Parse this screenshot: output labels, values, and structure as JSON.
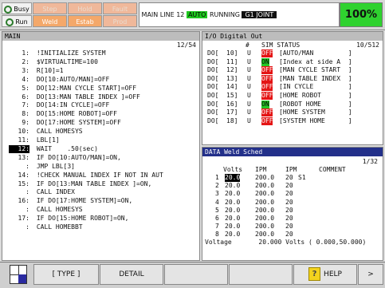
{
  "status": {
    "busy": "Busy",
    "step": "Step",
    "hold": "Hold",
    "fault": "Fault",
    "run": "Run",
    "weld": "Weld",
    "estab": "Estab",
    "prod": "Prod",
    "msg_prefix": "MAIN  LINE 12",
    "auto": "AUTO",
    "running": "RUNNING",
    "group": "G1  JOINT",
    "override": "100%"
  },
  "program": {
    "title": "MAIN",
    "position": "12/54",
    "lines": [
      {
        "num": "1:",
        "text": " !INITIALIZE SYSTEM"
      },
      {
        "num": "2:",
        "text": " $VIRTUALTIME=100"
      },
      {
        "num": "3:",
        "text": " R[10]=1"
      },
      {
        "num": "4:",
        "text": " DO[10:AUTO/MAN]=OFF"
      },
      {
        "num": "5:",
        "text": " DO[12:MAN CYCLE START]=OFF"
      },
      {
        "num": "6:",
        "text": " DO[13:MAN TABLE INDEX ]=OFF"
      },
      {
        "num": "7:",
        "text": " DO[14:IN CYCLE]=OFF"
      },
      {
        "num": "8:",
        "text": " DO[15:HOME ROBOT]=OFF"
      },
      {
        "num": "9:",
        "text": " DO[17:HOME SYSTEM]=OFF"
      },
      {
        "num": "10:",
        "text": " CALL HOMESYS"
      },
      {
        "num": "11:",
        "text": " LBL[1]"
      },
      {
        "num": "12:",
        "text": " WAIT    .50(sec)"
      },
      {
        "num": "13:",
        "text": " IF DO[10:AUTO/MAN]=ON,"
      },
      {
        "num": ":",
        "text": " JMP LBL[3]"
      },
      {
        "num": "14:",
        "text": " !CHECK MANUAL INDEX IF NOT IN AUT"
      },
      {
        "num": "15:",
        "text": " IF DO[13:MAN TABLE INDEX ]=ON,"
      },
      {
        "num": ":",
        "text": " CALL INDEX"
      },
      {
        "num": "16:",
        "text": " IF DO[17:HOME SYSTEM]=ON,"
      },
      {
        "num": ":",
        "text": " CALL HOMESYS"
      },
      {
        "num": "17:",
        "text": " IF DO[15:HOME ROBOT]=ON,"
      },
      {
        "num": ":",
        "text": " CALL HOMEBBT"
      }
    ]
  },
  "io": {
    "title": "I/O Digital Out",
    "header_num": "#",
    "header_sim": "SIM STATUS",
    "position": "10/512",
    "rows": [
      {
        "prefix": "DO[",
        "num": "10]",
        "sim": "U",
        "status": "OFF",
        "comment": "[AUTO/MAN         ]"
      },
      {
        "prefix": "DO[",
        "num": "11]",
        "sim": "U",
        "status": "ON",
        "comment": "[Index at side A  ]"
      },
      {
        "prefix": "DO[",
        "num": "12]",
        "sim": "U",
        "status": "OFF",
        "comment": "[MAN CYCLE START  ]"
      },
      {
        "prefix": "DO[",
        "num": "13]",
        "sim": "U",
        "status": "OFF",
        "comment": "[MAN TABLE INDEX  ]"
      },
      {
        "prefix": "DO[",
        "num": "14]",
        "sim": "U",
        "status": "OFF",
        "comment": "[IN CYCLE         ]"
      },
      {
        "prefix": "DO[",
        "num": "15]",
        "sim": "U",
        "status": "OFF",
        "comment": "[HOME ROBOT       ]"
      },
      {
        "prefix": "DO[",
        "num": "16]",
        "sim": "U",
        "status": "ON",
        "comment": "[ROBOT HOME       ]"
      },
      {
        "prefix": "DO[",
        "num": "17]",
        "sim": "U",
        "status": "OFF",
        "comment": "[HOME SYSTEM      ]"
      },
      {
        "prefix": "DO[",
        "num": "18]",
        "sim": "U",
        "status": "OFF",
        "comment": "[SYSTEM HOME      ]"
      }
    ]
  },
  "weld": {
    "title": "DATA Weld Sched",
    "position": "1/32",
    "headers": {
      "volts": "Volts",
      "ipm1": "IPM",
      "ipm2": "IPM",
      "comment": "COMMENT"
    },
    "rows": [
      {
        "n": "1",
        "volts": "20.0",
        "ipm1": "200.0",
        "ipm2": "20",
        "comment": "S1"
      },
      {
        "n": "2",
        "volts": "20.0",
        "ipm1": "200.0",
        "ipm2": "20",
        "comment": ""
      },
      {
        "n": "3",
        "volts": "20.0",
        "ipm1": "200.0",
        "ipm2": "20",
        "comment": ""
      },
      {
        "n": "4",
        "volts": "20.0",
        "ipm1": "200.0",
        "ipm2": "20",
        "comment": ""
      },
      {
        "n": "5",
        "volts": "20.0",
        "ipm1": "200.0",
        "ipm2": "20",
        "comment": ""
      },
      {
        "n": "6",
        "volts": "20.0",
        "ipm1": "200.0",
        "ipm2": "20",
        "comment": ""
      },
      {
        "n": "7",
        "volts": "20.0",
        "ipm1": "200.0",
        "ipm2": "20",
        "comment": ""
      },
      {
        "n": "8",
        "volts": "20.0",
        "ipm1": "200.0",
        "ipm2": "20",
        "comment": ""
      }
    ],
    "footer": "Voltage       20.000 Volts ( 0.000,50.000)"
  },
  "softkeys": {
    "type": "[ TYPE ]",
    "detail": "DETAIL",
    "help": "HELP",
    "next": ">"
  },
  "colors": {
    "on": "#25c825",
    "off": "#e41414",
    "override": "#2fd22f",
    "weld_title": "#23308a"
  }
}
